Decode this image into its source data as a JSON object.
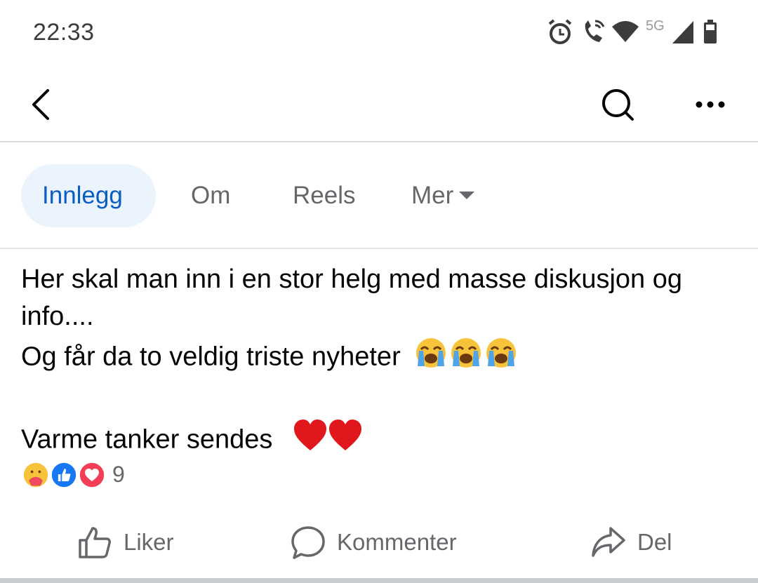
{
  "status_bar": {
    "time": "22:33",
    "network_label": "5G",
    "icons": [
      "alarm-icon",
      "wifi-call-icon",
      "wifi-icon",
      "signal-icon",
      "battery-icon"
    ]
  },
  "top_bar": {
    "icons": [
      "back-arrow-icon",
      "search-icon",
      "more-options-icon"
    ]
  },
  "tabs": [
    {
      "label": "Innlegg",
      "active": true
    },
    {
      "label": "Om",
      "active": false
    },
    {
      "label": "Reels",
      "active": false
    },
    {
      "label": "Mer",
      "active": false
    }
  ],
  "post": {
    "line1": "Her skal man inn i en stor helg med masse diskusjon og",
    "line2": "info....",
    "line3": "Og får da to veldig triste nyheter",
    "line3_emoji": [
      "crying-face",
      "crying-face",
      "crying-face"
    ],
    "line4": "Varme tanker sendes",
    "line4_emoji": [
      "red-heart",
      "red-heart"
    ]
  },
  "reactions": {
    "types": [
      "care",
      "like",
      "love"
    ],
    "count": "9"
  },
  "actions": {
    "like": "Liker",
    "comment": "Kommenter",
    "share": "Del"
  },
  "colors": {
    "accent_blue": "#0a5dc2",
    "active_tab_bg": "#ebf3fd",
    "secondary_text": "#65676b"
  }
}
